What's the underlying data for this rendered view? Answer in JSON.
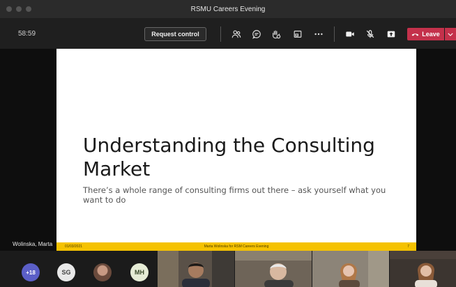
{
  "window": {
    "title": "RSMU Careers Evening"
  },
  "toolbar": {
    "timer": "58:59",
    "request_control": "Request control",
    "leave": "Leave",
    "icons": [
      "people-icon",
      "chat-icon",
      "reactions-icon",
      "rooms-icon",
      "more-icon",
      "camera-icon",
      "mic-off-icon",
      "share-icon"
    ]
  },
  "slide": {
    "title": "Understanding the Consulting Market",
    "subtitle": "There’s a whole range of consulting firms out there – ask yourself what you want to do",
    "footer_date": "01/03/2021",
    "footer_text": "Marta Wolinska for RSM Careers Evening",
    "page": "7"
  },
  "presenter": {
    "name": "Wolinska, Marta"
  },
  "gallery": {
    "more_count": "+18",
    "initials": [
      "SG",
      "MH"
    ]
  },
  "colors": {
    "leave": "#c4314b",
    "footer": "#f5c200",
    "accent": "#5b5fc7"
  }
}
